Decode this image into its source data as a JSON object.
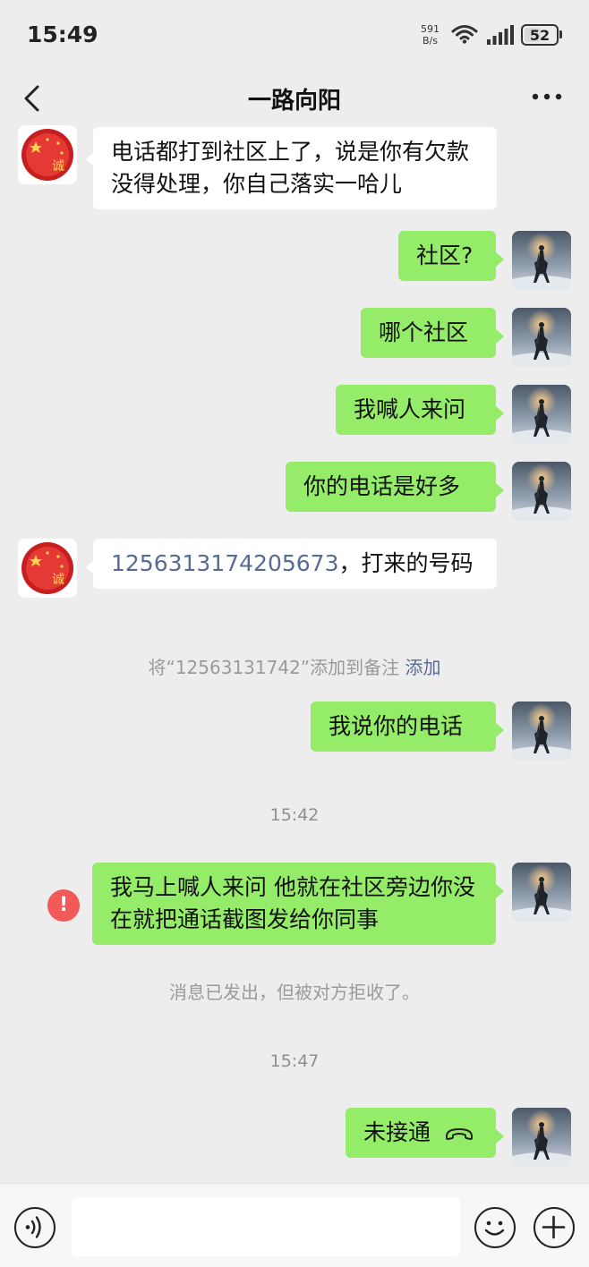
{
  "status_bar": {
    "time": "15:49",
    "net_speed_value": "591",
    "net_speed_unit": "B/s",
    "battery": "52",
    "battery_level": 0.52
  },
  "nav": {
    "title": "一路向阳"
  },
  "messages": [
    {
      "side": "left",
      "text": "电话都打到社区上了，说是你有欠款没得处理，你自己落实一哈儿"
    },
    {
      "side": "right",
      "text": "社区?"
    },
    {
      "side": "right",
      "text": "哪个社区"
    },
    {
      "side": "right",
      "text": "我喊人来问"
    },
    {
      "side": "right",
      "text": "你的电话是好多"
    },
    {
      "side": "left",
      "number": "1256313174205673",
      "text": "，打来的号码"
    },
    {
      "side": "right",
      "text": "我说你的电话"
    },
    {
      "side": "right",
      "text": "我马上喊人来问 他就在社区旁边你没在就把通话截图发给你同事",
      "error_icon": "exclamation-icon"
    },
    {
      "side": "right",
      "text": "未接通",
      "icon": "hangup-phone-icon"
    }
  ],
  "system": {
    "remark_prompt": "将“12563131742”添加到备注",
    "remark_link": "添加",
    "time_1": "15:42",
    "rejected_notice": "消息已发出，但被对方拒收了。",
    "time_2": "15:47"
  },
  "avatars": {
    "contact": "red-emblem-avatar",
    "self": "horse-rider-avatar"
  },
  "input_bar": {
    "voice_icon": "voice-icon",
    "emoji_icon": "emoji-icon",
    "plus_icon": "plus-icon",
    "placeholder": ""
  },
  "colors": {
    "background": "#ededed",
    "self_bubble": "#95ec69",
    "other_bubble": "#ffffff",
    "link": "#576b95",
    "error": "#f25a5a"
  }
}
